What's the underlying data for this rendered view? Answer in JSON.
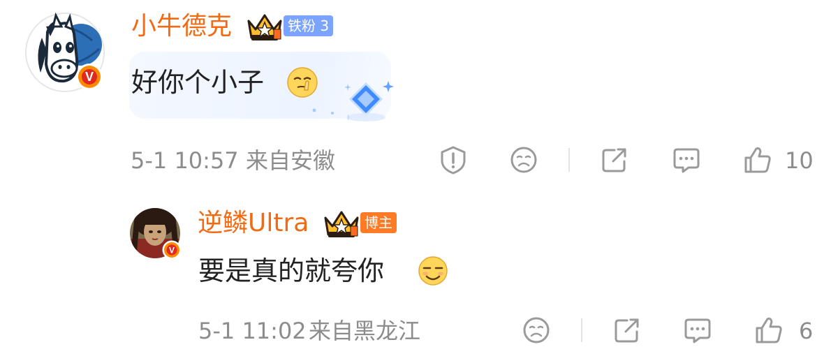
{
  "comments": [
    {
      "username": "小牛德克",
      "fan_badge": "铁粉 3",
      "content": "好你个小子",
      "emoji": "shush-face-emoji",
      "time": "5-1 10:57",
      "location": "来自安徽",
      "like_count": "10",
      "verified_badge": "V"
    },
    {
      "username": "逆鳞Ultra",
      "role_badge": "博主",
      "content": "要是真的就夸你",
      "emoji": "smirk-face-emoji",
      "time": "5-1 11:02",
      "location": "来自黑龙江",
      "like_count": "6",
      "verified_badge": "V"
    }
  ],
  "colors": {
    "username": "#f26a12",
    "fan_badge": "#7aa4ff",
    "blogger_badge": "#ff7a24",
    "meta_text": "#8c8c8c",
    "icon_gray": "#9a9a9a"
  }
}
